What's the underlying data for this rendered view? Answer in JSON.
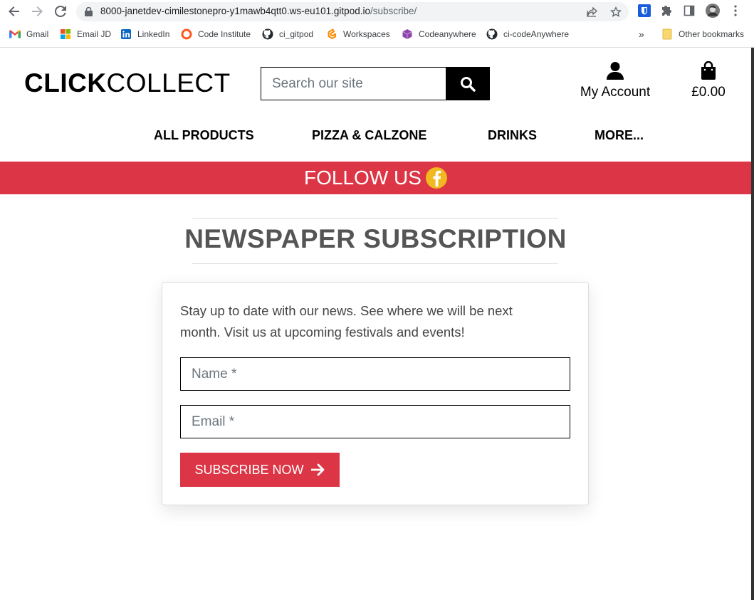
{
  "browser": {
    "url_host": "8000-janetdev-cimilestonepro-y1mawb4qtt0.ws-eu101.gitpod.io",
    "url_path": "/subscribe/",
    "bookmarks": [
      {
        "label": "Gmail",
        "icon": "gmail-icon"
      },
      {
        "label": "Email JD",
        "icon": "microsoft-icon"
      },
      {
        "label": "LinkedIn",
        "icon": "linkedin-icon"
      },
      {
        "label": "Code Institute",
        "icon": "code-institute-icon"
      },
      {
        "label": "ci_gitpod",
        "icon": "github-icon"
      },
      {
        "label": "Workspaces",
        "icon": "gitpod-icon"
      },
      {
        "label": "Codeanywhere",
        "icon": "codeanywhere-icon"
      },
      {
        "label": "ci-codeAnywhere",
        "icon": "github-icon"
      }
    ],
    "more_bookmarks": "»",
    "other_bookmarks": "Other bookmarks"
  },
  "header": {
    "logo_bold": "CLICK",
    "logo_thin": "COLLECT",
    "search_placeholder": "Search our site",
    "account_label": "My Account",
    "bag_total": "£0.00"
  },
  "nav": {
    "items": [
      "ALL PRODUCTS",
      "PIZZA & CALZONE",
      "DRINKS",
      "MORE..."
    ]
  },
  "banner": {
    "follow_text": "FOLLOW US"
  },
  "main": {
    "title": "NEWSPAPER SUBSCRIPTION",
    "intro": "Stay up to date with our news. See where we will be next month. Visit us at upcoming festivals and events!",
    "name_placeholder": "Name *",
    "email_placeholder": "Email *",
    "submit_label": "SUBSCRIBE NOW"
  },
  "colors": {
    "accent": "#dc3545",
    "facebook_badge": "#f2b81f"
  }
}
